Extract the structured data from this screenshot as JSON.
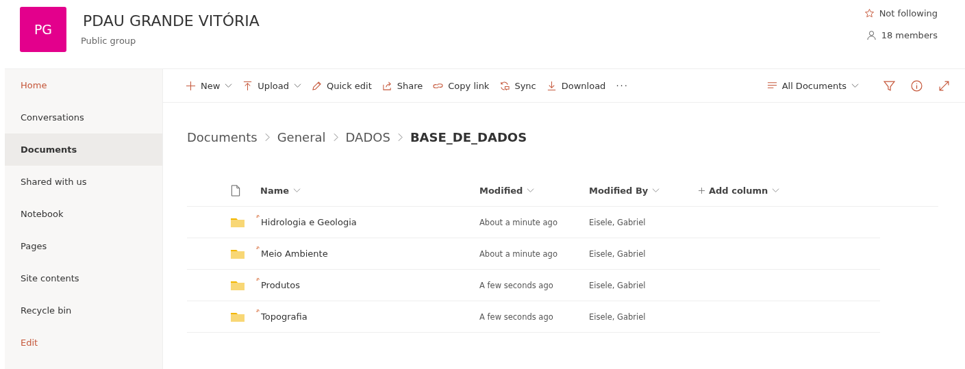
{
  "site": {
    "logo": "PG",
    "title": "PDAU GRANDE VITÓRIA",
    "subtitle": "Public group",
    "follow": "Not following",
    "members": "18 members"
  },
  "sidebar": {
    "items": [
      {
        "label": "Home",
        "kind": "accent",
        "selected": false
      },
      {
        "label": "Conversations",
        "kind": "nav",
        "selected": false
      },
      {
        "label": "Documents",
        "kind": "nav",
        "selected": true
      },
      {
        "label": "Shared with us",
        "kind": "nav",
        "selected": false
      },
      {
        "label": "Notebook",
        "kind": "nav",
        "selected": false
      },
      {
        "label": "Pages",
        "kind": "nav",
        "selected": false
      },
      {
        "label": "Site contents",
        "kind": "nav",
        "selected": false
      },
      {
        "label": "Recycle bin",
        "kind": "nav",
        "selected": false
      },
      {
        "label": "Edit",
        "kind": "accent",
        "selected": false
      }
    ]
  },
  "toolbar": {
    "commands": [
      {
        "label": "New",
        "kind": "plus",
        "dropdown": true
      },
      {
        "label": "Upload",
        "kind": "upload",
        "dropdown": true
      },
      {
        "label": "Quick edit",
        "kind": "pencil",
        "dropdown": false
      },
      {
        "label": "Share",
        "kind": "share",
        "dropdown": false
      },
      {
        "label": "Copy link",
        "kind": "link",
        "dropdown": false
      },
      {
        "label": "Sync",
        "kind": "sync",
        "dropdown": false
      },
      {
        "label": "Download",
        "kind": "download",
        "dropdown": false
      }
    ],
    "more": "···",
    "view": "All Documents"
  },
  "breadcrumb": [
    "Documents",
    "General",
    "DADOS",
    "BASE_DE_DADOS"
  ],
  "table": {
    "columns": [
      "Name",
      "Modified",
      "Modified By",
      "Add column"
    ],
    "rows": [
      {
        "name": "Hidrologia e Geologia",
        "modified": "About a minute ago",
        "modified_by": "Eisele, Gabriel"
      },
      {
        "name": "Meio Ambiente",
        "modified": "About a minute ago",
        "modified_by": "Eisele, Gabriel"
      },
      {
        "name": "Produtos",
        "modified": "A few seconds ago",
        "modified_by": "Eisele, Gabriel"
      },
      {
        "name": "Topografia",
        "modified": "A few seconds ago",
        "modified_by": "Eisele, Gabriel"
      }
    ]
  }
}
